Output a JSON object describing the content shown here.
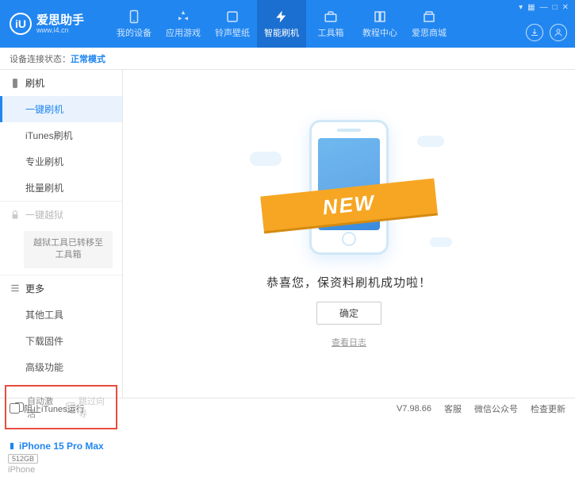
{
  "app": {
    "name": "爱思助手",
    "url": "www.i4.cn",
    "logo": "iU"
  },
  "nav": [
    {
      "label": "我的设备"
    },
    {
      "label": "应用游戏"
    },
    {
      "label": "铃声壁纸"
    },
    {
      "label": "智能刷机"
    },
    {
      "label": "工具箱"
    },
    {
      "label": "教程中心"
    },
    {
      "label": "爱思商城"
    }
  ],
  "window_ctrl": {
    "more": "▾",
    "sep": "▦",
    "min": "—",
    "max": "□",
    "close": "✕"
  },
  "status": {
    "label": "设备连接状态：",
    "mode": "正常模式"
  },
  "sidebar": {
    "flash": {
      "title": "刷机",
      "items": [
        "一键刷机",
        "iTunes刷机",
        "专业刷机",
        "批量刷机"
      ]
    },
    "jailbreak": {
      "title": "一键越狱",
      "note": "越狱工具已转移至工具箱"
    },
    "more": {
      "title": "更多",
      "items": [
        "其他工具",
        "下载固件",
        "高级功能"
      ]
    },
    "checks": {
      "auto_activate": "自动激活",
      "skip_setup": "跳过向导"
    },
    "device": {
      "name": "iPhone 15 Pro Max",
      "storage": "512GB",
      "type": "iPhone"
    }
  },
  "main": {
    "ribbon": "NEW",
    "success": "恭喜您，保资料刷机成功啦！",
    "ok": "确定",
    "log": "查看日志"
  },
  "footer": {
    "block_itunes": "阻止iTunes运行",
    "version": "V7.98.66",
    "links": [
      "客服",
      "微信公众号",
      "检查更新"
    ]
  }
}
